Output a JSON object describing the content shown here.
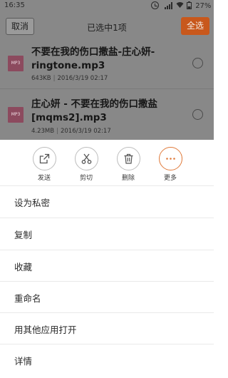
{
  "status_bar": {
    "time": "16:35",
    "battery": "27%"
  },
  "top_bar": {
    "cancel_label": "取消",
    "title": "已选中1项",
    "select_all_label": "全选"
  },
  "files": [
    {
      "icon_text": "MP3",
      "name_line1": "不要在我的伤口撒盐-庄心妍-",
      "name_line2": "ringtone.mp3",
      "size": "643KB",
      "date": "2016/3/19 02:17"
    },
    {
      "icon_text": "MP3",
      "name_line1": "庄心妍 - 不要在我的伤口撒盐",
      "name_line2": "[mqms2].mp3",
      "size": "4.23MB",
      "date": "2016/3/19 02:17"
    }
  ],
  "actions": [
    {
      "label": "发送",
      "icon": "share-icon"
    },
    {
      "label": "剪切",
      "icon": "scissors-icon"
    },
    {
      "label": "删除",
      "icon": "trash-icon"
    },
    {
      "label": "更多",
      "icon": "more-icon"
    }
  ],
  "menu": [
    "设为私密",
    "复制",
    "收藏",
    "重命名",
    "用其他应用打开",
    "详情"
  ],
  "colors": {
    "accent": "#c8581c",
    "dim_overlay": "#888888",
    "mp3_icon": "#8c4a5e"
  }
}
